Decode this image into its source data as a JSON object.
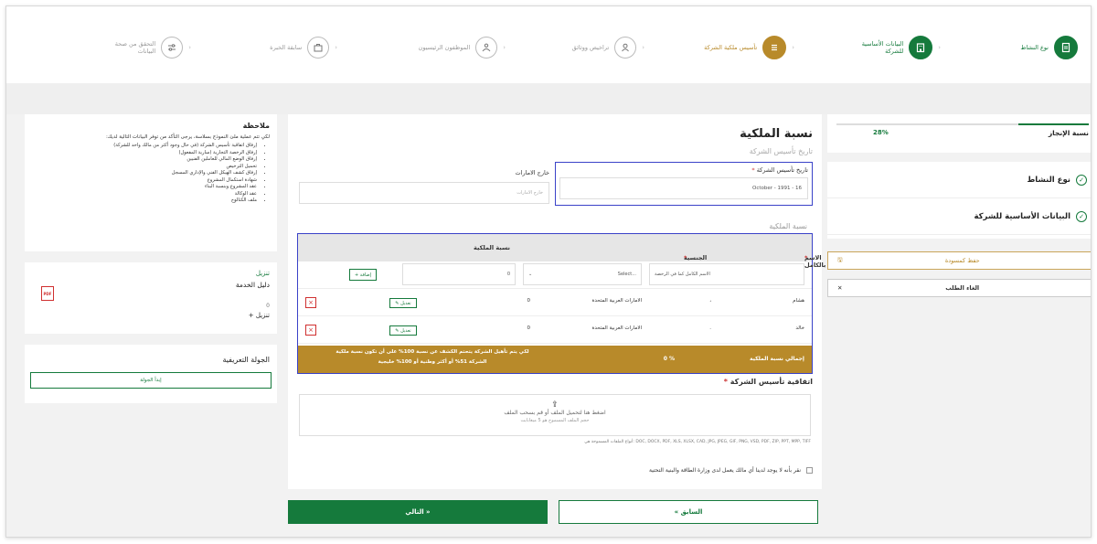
{
  "stepper": {
    "steps": [
      {
        "label": "نوع النشاط",
        "state": "done",
        "icon": "document-icon"
      },
      {
        "label": "البيانات الأساسية للشركة",
        "state": "done",
        "icon": "building-icon"
      },
      {
        "label": "تأسيس ملكية الشركة",
        "state": "active",
        "icon": "list-icon"
      },
      {
        "label": "تراخيص ووثائق",
        "state": "pending",
        "icon": "user-icon"
      },
      {
        "label": "الموظفون الرئيسيون",
        "state": "pending",
        "icon": "people-icon"
      },
      {
        "label": "سابقة الخبرة",
        "state": "pending",
        "icon": "briefcase-icon"
      },
      {
        "label": "التحقق من صحة البيانات",
        "state": "pending",
        "icon": "sliders-icon"
      }
    ]
  },
  "progress": {
    "label": "نسبة الإنجاز",
    "value_text": "28%",
    "value": 0.28
  },
  "side_nav": {
    "items": [
      {
        "label": "نوع النشاط"
      },
      {
        "label": "البيانات الأساسية للشركة"
      }
    ],
    "save_draft": "حفظ كمسودة",
    "cancel": "الغاء الطلب"
  },
  "main": {
    "title": "نسبة الملكية",
    "subtitle": "تاريخ تأسيس الشركة",
    "date_label": "تاريخ تأسيس الشركة",
    "date_value": "16 - 1991 - October",
    "outside_label": "خارج الامارات",
    "outside_placeholder": "خارج الامارات",
    "ownership_subtitle": "نسبة الملكية",
    "table": {
      "headers": {
        "name": "الاسم بالكامل",
        "nationality": "الجنسية",
        "share": "نسبة الملكية"
      },
      "name_placeholder": "الاسم الكامل كما في الرخصة",
      "select_placeholder": "Select...",
      "share_default": "0",
      "add_label": "+ إضافة",
      "edit_label": "تعديل",
      "rows": [
        {
          "name": "هشام",
          "mid": "،",
          "nationality": "الامارات العربية المتحدة",
          "share": "0"
        },
        {
          "name": "خالد",
          "mid": ".",
          "nationality": "الامارات العربية المتحدة",
          "share": "0"
        }
      ],
      "total_label": "إجمالي نسبة الملكية",
      "total_value": "0 %",
      "total_note_1": "لكي يتم تأهيل الشركة يتحتم الكشف عن نسبة 100% على أن تكون نسبة ملكية",
      "total_note_2": "الشركة 51% أو أكثر وطنية أو 100% خليجية"
    },
    "contract_label": "اتفاقية تأسيس الشركة",
    "upload_text": "اضغط هنا لتحميل الملف أو قم بسحب الملف",
    "upload_limit": "حجم الملف المسموح هو 5 ميغابايت",
    "file_types": "أنواع الملفات المسموحة هي: DOC, DOCX, PDF, XLS, XLSX, CAD, JPG, JPEG, GIF, PNG, VSD, PDF, ZIP, PPT, MPP, TIFF",
    "consent": "نقر بأنه لا يوجد لدينا أي مالك يعمل لدى وزارة الطاقة والبنية التحتية"
  },
  "note": {
    "title": "ملاحظة",
    "intro": "لكي تتم عملية ملئ النموذج بسلاسة، يرجى التأكد من توفر البيانات التالية لديك:",
    "items": [
      "إرفاق اتفاقية تأسيس الشركة (في حال وجود أكثر من مالك واحد للشركة)",
      "إرفاق الرخصة التجارية (سارية المفعول)",
      "إرفاق الوضع المالي للعاملين الفنيين",
      "تحميل الترخيص",
      "إرفاق كشف الهيكل الفني والإداري المسجل",
      "شهادة استكمال المشروع",
      "عقد المشروع وبنسبة البناء",
      "عقد الوكالة",
      "ملف الكتالوج"
    ]
  },
  "download": {
    "title": "تنزيل",
    "doc_name": "دليل الخدمة",
    "count": "0",
    "action": "+ تنزيل",
    "badge": "PDF"
  },
  "tour": {
    "title": "الجولة التعريفية",
    "button": "إبدأ الجولة"
  },
  "footer": {
    "next": "التالي »",
    "prev": "« السابق"
  }
}
